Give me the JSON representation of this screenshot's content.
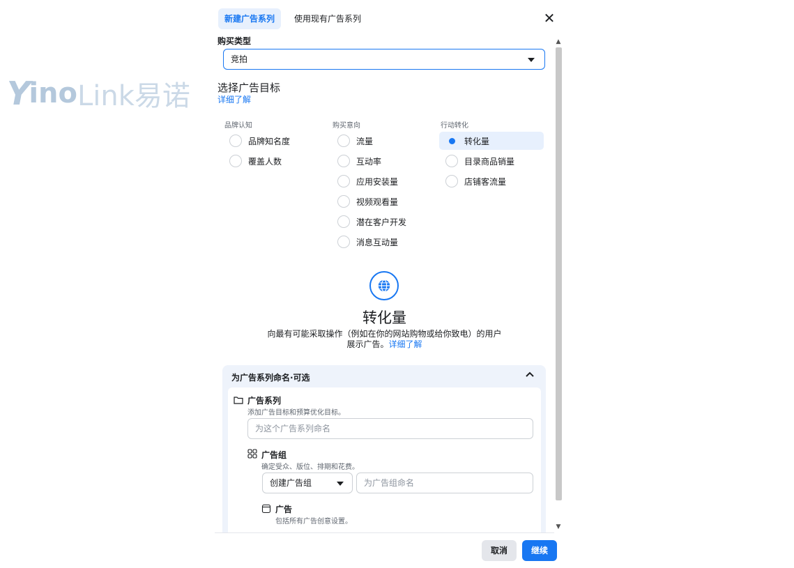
{
  "watermark": {
    "brand_y": "Y",
    "brand_ino": "ino",
    "brand_link": "Link易诺"
  },
  "tabs": [
    {
      "label": "新建广告系列",
      "active": true
    },
    {
      "label": "使用现有广告系列",
      "active": false
    }
  ],
  "buy_type": {
    "label": "购买类型",
    "value": "竞拍"
  },
  "objective": {
    "title": "选择广告目标",
    "learn_more": "详细了解",
    "columns": [
      {
        "header": "品牌认知",
        "options": [
          "品牌知名度",
          "覆盖人数"
        ]
      },
      {
        "header": "购买意向",
        "options": [
          "流量",
          "互动率",
          "应用安装量",
          "视频观看量",
          "潜在客户开发",
          "消息互动量"
        ]
      },
      {
        "header": "行动转化",
        "options": [
          "转化量",
          "目录商品销量",
          "店铺客流量"
        ]
      }
    ],
    "selected": "转化量"
  },
  "detail": {
    "icon": "globe-icon",
    "title": "转化量",
    "description_line1": "向最有可能采取操作（例如在你的网站购物或给你致电）的用户",
    "description_line2": "展示广告。",
    "description_link": "详细了解"
  },
  "naming": {
    "title": "为广告系列命名·可选",
    "campaign": {
      "title": "广告系列",
      "subtitle": "添加广告目标和预算优化目标。",
      "placeholder": "为这个广告系列命名"
    },
    "adset": {
      "title": "广告组",
      "subtitle": "确定受众、版位、排期和花费。",
      "dropdown_value": "创建广告组",
      "placeholder": "为广告组命名"
    },
    "ad": {
      "title": "广告",
      "subtitle": "包括所有广告创意设置。"
    }
  },
  "footer": {
    "cancel": "取消",
    "continue": "继续"
  },
  "colors": {
    "accent": "#1877f2",
    "selected_bg": "#e7f0fd",
    "panel_bg": "#eef3fb"
  }
}
